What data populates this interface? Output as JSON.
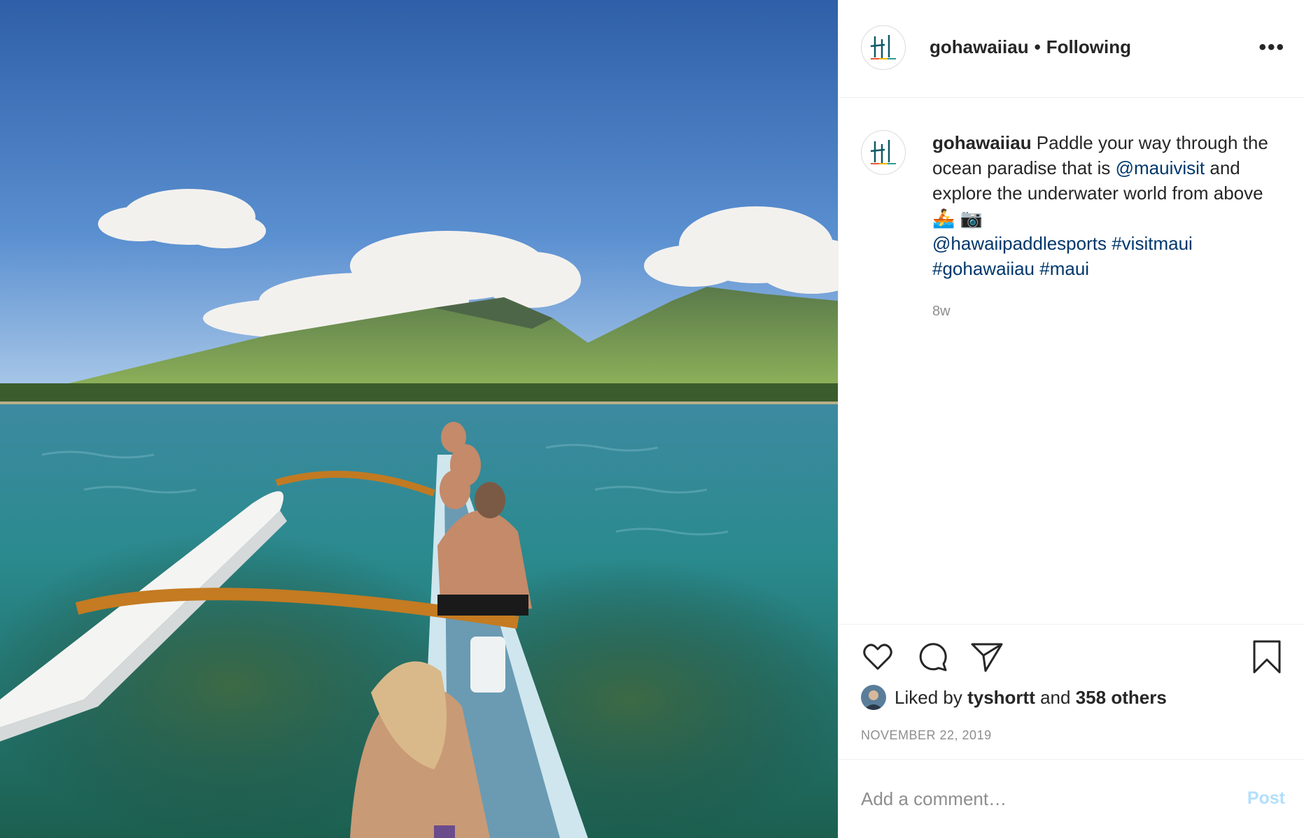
{
  "header": {
    "username": "gohawaiiau",
    "separator": "•",
    "follow_status": "Following",
    "more_icon": "more-horizontal-icon"
  },
  "caption": {
    "username": "gohawaiiau",
    "text_1": " Paddle your way through the ocean paradise that is ",
    "mention_1": "@mauivisit",
    "text_2": " and explore the underwater world from above ",
    "emoji": "🚣 📷",
    "mention_2": "@hawaiipaddlesports",
    "tag_1": "#visitmaui",
    "tag_2": "#gohawaiiau",
    "tag_3": "#maui",
    "time": "8w"
  },
  "actions": {
    "like_icon": "heart-icon",
    "comment_icon": "comment-icon",
    "share_icon": "paper-plane-icon",
    "save_icon": "bookmark-icon"
  },
  "likes": {
    "prefix": "Liked by",
    "user": "tyshortt",
    "conj": "and",
    "others": "358 others"
  },
  "date": "NOVEMBER 22, 2019",
  "comment": {
    "placeholder": "Add a comment…",
    "post_label": "Post"
  },
  "colors": {
    "link": "#00376b",
    "muted": "#8e8e8e",
    "post_disabled": "#b2dffc",
    "logo_teal": "#0e5a67"
  }
}
